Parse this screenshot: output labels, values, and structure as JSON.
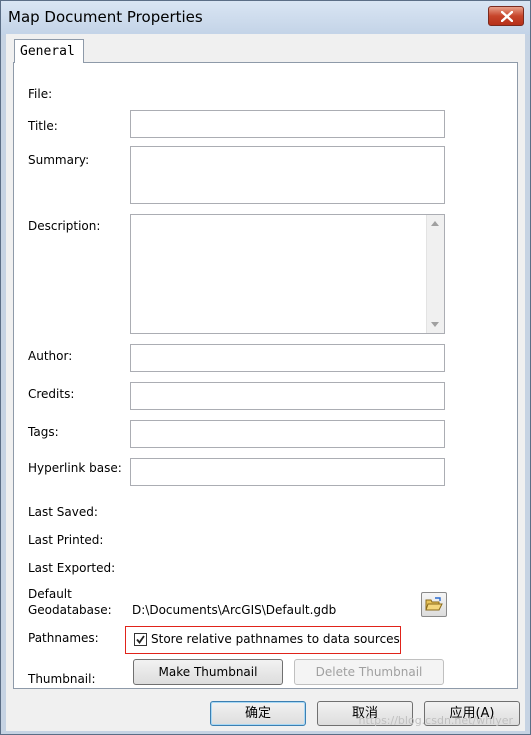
{
  "window": {
    "title": "Map Document Properties"
  },
  "tabs": [
    {
      "label": "General",
      "selected": true
    }
  ],
  "fields": {
    "file": {
      "label": "File:"
    },
    "title": {
      "label": "Title:",
      "value": ""
    },
    "summary": {
      "label": "Summary:",
      "value": ""
    },
    "description": {
      "label": "Description:",
      "value": ""
    },
    "author": {
      "label": "Author:",
      "value": ""
    },
    "credits": {
      "label": "Credits:",
      "value": ""
    },
    "tags": {
      "label": "Tags:",
      "value": ""
    },
    "hyperlink_base": {
      "label": "Hyperlink base:",
      "value": ""
    },
    "last_saved": {
      "label": "Last Saved:"
    },
    "last_printed": {
      "label": "Last Printed:"
    },
    "last_exported": {
      "label": "Last Exported:"
    },
    "default_geodatabase": {
      "label_line1": "Default",
      "label_line2": "Geodatabase:",
      "value": "D:\\Documents\\ArcGIS\\Default.gdb"
    },
    "pathnames": {
      "label": "Pathnames:",
      "checkbox_label": "Store relative pathnames to data sources",
      "checked": true
    },
    "thumbnail": {
      "label": "Thumbnail:",
      "make_label": "Make Thumbnail",
      "delete_label": "Delete Thumbnail"
    }
  },
  "buttons": {
    "ok": "确定",
    "cancel": "取消",
    "apply": "应用(A)"
  },
  "watermark": "https://blog.csdn.net/whlyer",
  "icons": [
    "close-icon",
    "folder-open-icon",
    "checkmark-icon",
    "scroll-up-arrow-icon",
    "scroll-down-arrow-icon"
  ],
  "colors": {
    "highlight_border": "#e0231a",
    "close_button": "#c7452b",
    "title_bar": "#c6d3e3"
  }
}
